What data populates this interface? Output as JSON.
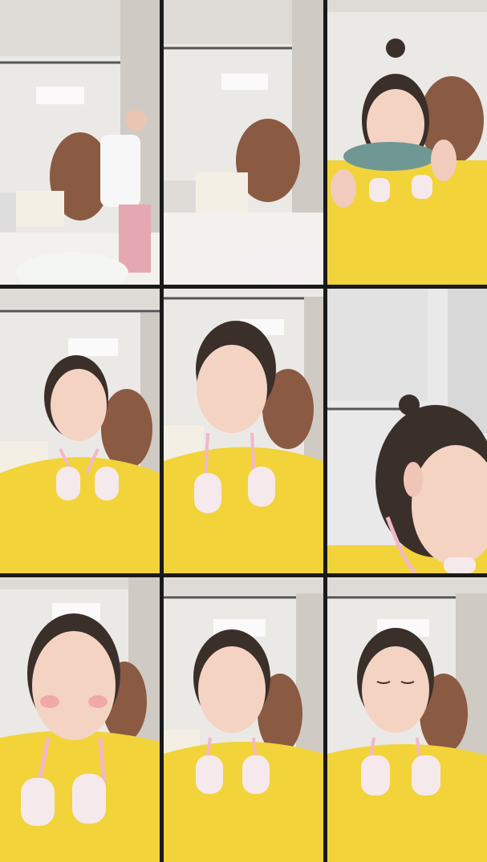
{
  "grid": {
    "rows": 3,
    "columns": 3,
    "frames": [
      {
        "scene": "wide-room-standing"
      },
      {
        "scene": "empty-room-chair"
      },
      {
        "scene": "drinking-from-bowl"
      },
      {
        "scene": "talking-close"
      },
      {
        "scene": "looking-down"
      },
      {
        "scene": "side-profile"
      },
      {
        "scene": "front-closeup"
      },
      {
        "scene": "front-mid"
      },
      {
        "scene": "eyes-closed"
      }
    ]
  },
  "colors": {
    "sweater": "#f2d33a",
    "skin": "#f4d3c3",
    "hair": "#3b2f2a",
    "wall": "#e9e7e4",
    "device": "#f6e9ec",
    "device_strap": "#f0b8c8",
    "chair": "#8a5a42",
    "ceiling": "#d9d6d1"
  },
  "icons": [
    "neck-massager-icon",
    "hanging-chair-icon",
    "air-conditioner-icon"
  ]
}
